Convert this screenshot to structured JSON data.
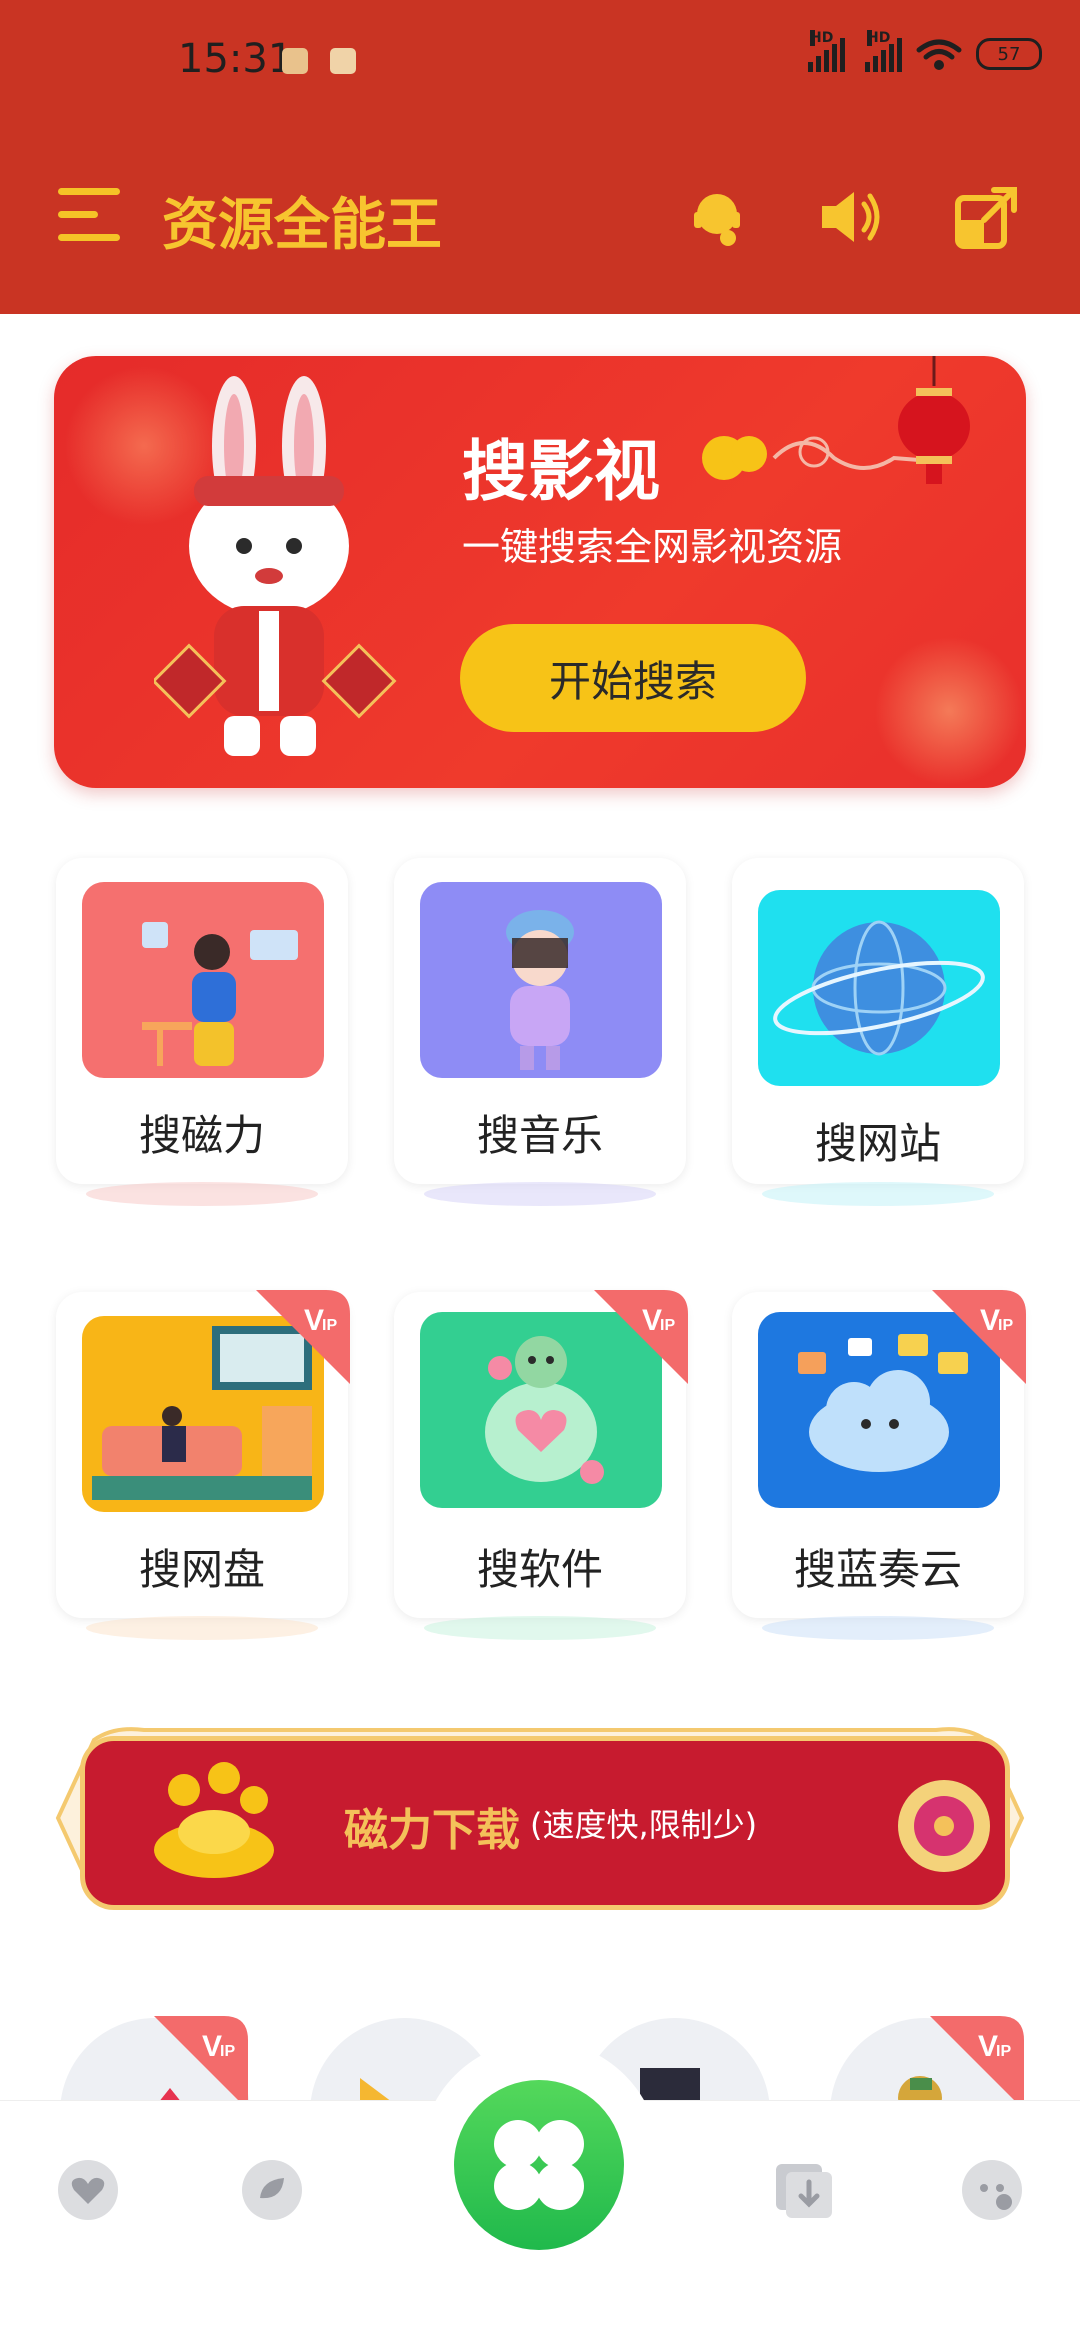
{
  "status": {
    "time": "15:31",
    "battery": "57",
    "hd1": "HD",
    "hd2": "HD"
  },
  "header": {
    "title": "资源全能王"
  },
  "banner": {
    "title": "搜影视",
    "subtitle": "一键搜索全网影视资源",
    "button": "开始搜索"
  },
  "grid": [
    {
      "label": "搜磁力",
      "vip": false
    },
    {
      "label": "搜音乐",
      "vip": false
    },
    {
      "label": "搜网站",
      "vip": false
    },
    {
      "label": "搜网盘",
      "vip": true
    },
    {
      "label": "搜软件",
      "vip": true
    },
    {
      "label": "搜蓝奏云",
      "vip": true
    }
  ],
  "promo": {
    "title": "磁力下载",
    "subtitle": "(速度快,限制少)"
  },
  "vip_text": "VIP",
  "colors": {
    "header": "#c93423",
    "accent": "#f7c52f",
    "banner": "#e52b2a",
    "button": "#f7c317"
  }
}
